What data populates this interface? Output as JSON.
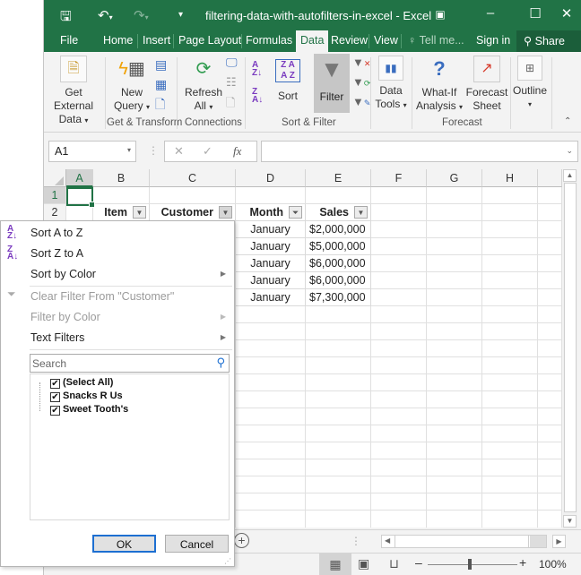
{
  "window": {
    "title": "filtering-data-with-autofilters-in-excel - Excel",
    "quick_access": [
      "save-icon",
      "undo-icon",
      "redo-icon",
      "customize-icon"
    ],
    "controls": [
      "ribbon-display-options",
      "minimize",
      "maximize",
      "close"
    ]
  },
  "tabs": [
    {
      "label": "File"
    },
    {
      "label": "Home"
    },
    {
      "label": "Insert"
    },
    {
      "label": "Page Layout"
    },
    {
      "label": "Formulas"
    },
    {
      "label": "Data",
      "active": true
    },
    {
      "label": "Review"
    },
    {
      "label": "View"
    }
  ],
  "tell_me": "Tell me...",
  "sign_in": "Sign in",
  "share": "Share",
  "ribbon": {
    "get_external_data": [
      "Get External",
      "Data"
    ],
    "new_query": [
      "New",
      "Query"
    ],
    "refresh_all": [
      "Refresh",
      "All"
    ],
    "sort": "Sort",
    "filter": "Filter",
    "data_tools": [
      "Data",
      "Tools"
    ],
    "what_if": [
      "What-If",
      "Analysis"
    ],
    "forecast_sheet": [
      "Forecast",
      "Sheet"
    ],
    "outline": "Outline",
    "groups": {
      "get_transform": "Get & Transform",
      "connections": "Connections",
      "sort_filter": "Sort & Filter",
      "forecast": "Forecast"
    }
  },
  "formula_bar": {
    "name_box": "A1",
    "fx": "fx",
    "value": ""
  },
  "columns": [
    "A",
    "B",
    "C",
    "D",
    "E",
    "F",
    "G",
    "H"
  ],
  "rows": [
    "1",
    "2"
  ],
  "headers": {
    "item": "Item",
    "customer": "Customer",
    "month": "Month",
    "sales": "Sales"
  },
  "data_rows": [
    {
      "month": "January",
      "sales": "$2,000,000"
    },
    {
      "month": "January",
      "sales": "$5,000,000"
    },
    {
      "month": "January",
      "sales": "$6,000,000"
    },
    {
      "month": "January",
      "sales": "$6,000,000"
    },
    {
      "month": "January",
      "sales": "$7,300,000"
    }
  ],
  "filter_menu": {
    "sort_az": "Sort A to Z",
    "sort_za": "Sort Z to A",
    "sort_by_color": "Sort by Color",
    "clear_filter": "Clear Filter From \"Customer\"",
    "filter_by_color": "Filter by Color",
    "text_filters": "Text Filters",
    "search_placeholder": "Search",
    "items": [
      {
        "label": "(Select All)",
        "checked": true
      },
      {
        "label": "Snacks R Us",
        "checked": true
      },
      {
        "label": "Sweet Tooth's",
        "checked": true
      }
    ],
    "ok": "OK",
    "cancel": "Cancel"
  },
  "status": {
    "zoom": "100%"
  },
  "colors": {
    "brand_green": "#217346",
    "ok_border": "#1d6fd1"
  }
}
